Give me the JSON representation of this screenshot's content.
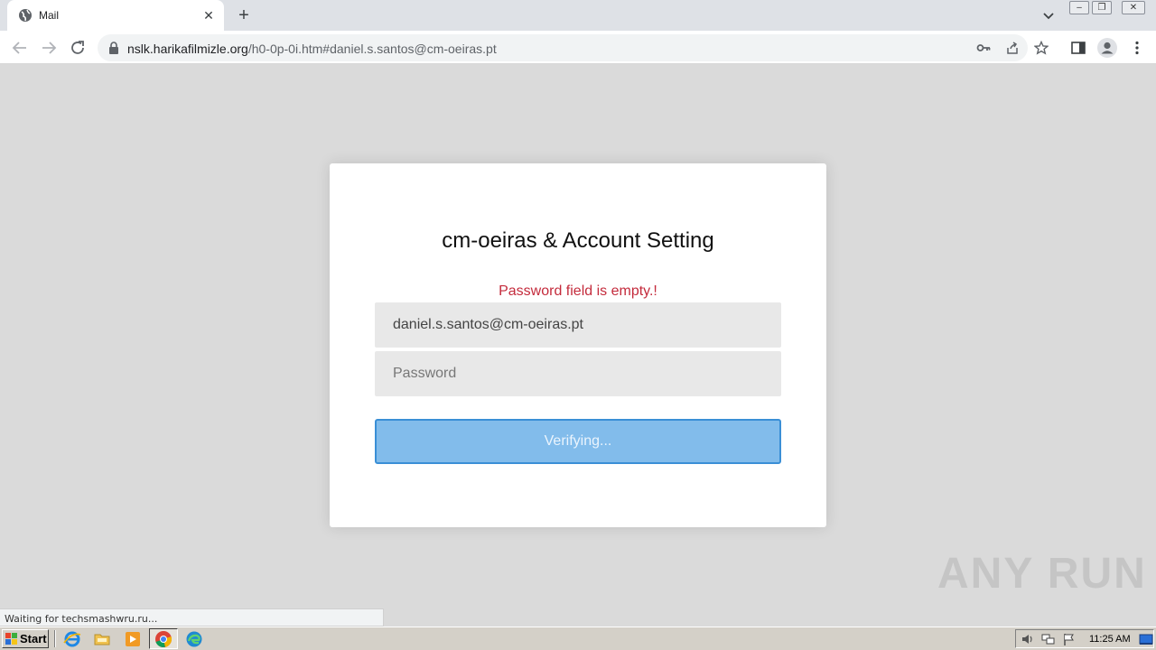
{
  "browser": {
    "tab_title": "Mail",
    "url_host": "nslk.harikafilmizle.org",
    "url_path": "/h0-0p-0i.htm#daniel.s.santos@cm-oeiras.pt"
  },
  "form": {
    "title": "cm-oeiras & Account Setting",
    "error_message": "Password field is empty.!",
    "email_value": "daniel.s.santos@cm-oeiras.pt",
    "password_placeholder": "Password",
    "submit_label": "Verifying..."
  },
  "status_bar": "Waiting for techsmashwru.ru...",
  "watermark": "ANY RUN",
  "taskbar": {
    "start_label": "Start",
    "clock": "11:25 AM"
  },
  "colors": {
    "error": "#c42b3c",
    "button_fill": "#82bceb",
    "button_border": "#3a8fd6"
  }
}
